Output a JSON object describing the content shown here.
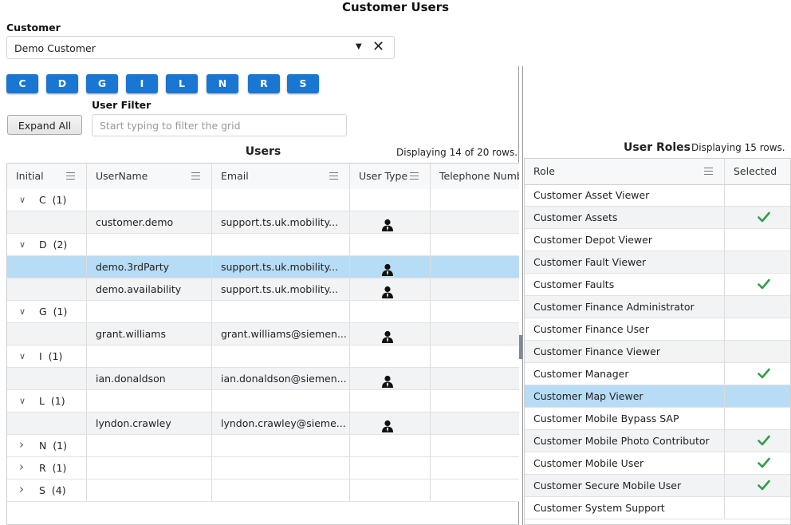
{
  "page_title": "Customer Users",
  "customer": {
    "label": "Customer",
    "value": "Demo Customer"
  },
  "letters": [
    "C",
    "D",
    "G",
    "I",
    "L",
    "N",
    "R",
    "S"
  ],
  "expand_all_label": "Expand All",
  "user_filter": {
    "label": "User Filter",
    "placeholder": "Start typing to filter the grid"
  },
  "users": {
    "title": "Users",
    "count_text": "Displaying 14 of 20 rows.",
    "columns": [
      "Initial",
      "UserName",
      "Email",
      "User Type",
      "Telephone Numb"
    ],
    "rows": [
      {
        "kind": "group",
        "label": "C  (1)",
        "expanded": true
      },
      {
        "kind": "user",
        "username": "customer.demo",
        "email": "support.ts.uk.mobility...",
        "selected": false
      },
      {
        "kind": "group",
        "label": "D  (2)",
        "expanded": true
      },
      {
        "kind": "user",
        "username": "demo.3rdParty",
        "email": "support.ts.uk.mobility...",
        "selected": true
      },
      {
        "kind": "user",
        "username": "demo.availability",
        "email": "support.ts.uk.mobility...",
        "selected": false
      },
      {
        "kind": "group",
        "label": "G  (1)",
        "expanded": true
      },
      {
        "kind": "user",
        "username": "grant.williams",
        "email": "grant.williams@siemen...",
        "selected": false
      },
      {
        "kind": "group",
        "label": "I  (1)",
        "expanded": true
      },
      {
        "kind": "user",
        "username": "ian.donaldson",
        "email": "ian.donaldson@siemen...",
        "selected": false
      },
      {
        "kind": "group",
        "label": "L  (1)",
        "expanded": true
      },
      {
        "kind": "user",
        "username": "lyndon.crawley",
        "email": "lyndon.crawley@sieme...",
        "selected": false
      },
      {
        "kind": "group",
        "label": "N  (1)",
        "expanded": false
      },
      {
        "kind": "group",
        "label": "R  (1)",
        "expanded": false
      },
      {
        "kind": "group",
        "label": "S  (4)",
        "expanded": false
      }
    ]
  },
  "roles": {
    "title": "User Roles",
    "count_text": "Displaying 15 rows.",
    "columns": [
      "Role",
      "Selected"
    ],
    "rows": [
      {
        "name": "Customer Asset Viewer",
        "selected": false,
        "highlight": false
      },
      {
        "name": "Customer Assets",
        "selected": true,
        "highlight": false
      },
      {
        "name": "Customer Depot Viewer",
        "selected": false,
        "highlight": false
      },
      {
        "name": "Customer Fault Viewer",
        "selected": false,
        "highlight": false
      },
      {
        "name": "Customer Faults",
        "selected": true,
        "highlight": false
      },
      {
        "name": "Customer Finance Administrator",
        "selected": false,
        "highlight": false
      },
      {
        "name": "Customer Finance User",
        "selected": false,
        "highlight": false
      },
      {
        "name": "Customer Finance Viewer",
        "selected": false,
        "highlight": false
      },
      {
        "name": "Customer Manager",
        "selected": true,
        "highlight": false
      },
      {
        "name": "Customer Map Viewer",
        "selected": false,
        "highlight": true
      },
      {
        "name": "Customer Mobile Bypass SAP",
        "selected": false,
        "highlight": false
      },
      {
        "name": "Customer Mobile Photo Contributor",
        "selected": true,
        "highlight": false
      },
      {
        "name": "Customer Mobile User",
        "selected": true,
        "highlight": false
      },
      {
        "name": "Customer Secure Mobile User",
        "selected": true,
        "highlight": false
      },
      {
        "name": "Customer System Support",
        "selected": false,
        "highlight": false
      }
    ]
  },
  "colors": {
    "accent": "#1976d2",
    "selection": "#b7dcf5",
    "check": "#2e9e47"
  }
}
